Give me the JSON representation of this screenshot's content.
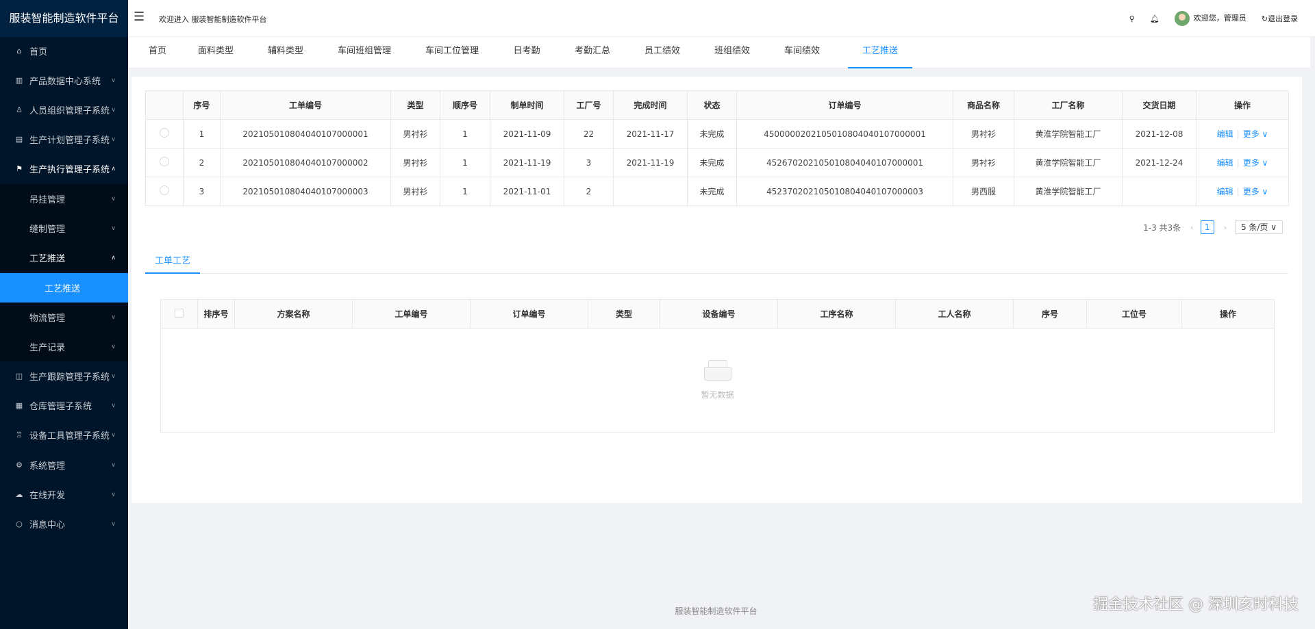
{
  "app": {
    "title": "服装智能制造软件平台"
  },
  "sidebar": {
    "items": [
      {
        "label": "首页",
        "icon": "home-icon"
      },
      {
        "label": "产品数据中心系统",
        "icon": "bank-icon"
      },
      {
        "label": "人员组织管理子系统",
        "icon": "user-icon"
      },
      {
        "label": "生产计划管理子系统",
        "icon": "plan-icon"
      },
      {
        "label": "生产执行管理子系统",
        "icon": "flag-icon"
      },
      {
        "label": "吊挂管理"
      },
      {
        "label": "缝制管理"
      },
      {
        "label": "工艺推送"
      },
      {
        "label": "工艺推送"
      },
      {
        "label": "物流管理"
      },
      {
        "label": "生产记录"
      },
      {
        "label": "生产跟踪管理子系统",
        "icon": "track-icon"
      },
      {
        "label": "仓库管理子系统",
        "icon": "warehouse-icon"
      },
      {
        "label": "设备工具管理子系统",
        "icon": "tool-icon"
      },
      {
        "label": "系统管理",
        "icon": "gear-icon"
      },
      {
        "label": "在线开发",
        "icon": "cloud-icon"
      },
      {
        "label": "消息中心",
        "icon": "message-icon"
      }
    ]
  },
  "header": {
    "welcome": "欢迎进入 服装智能制造软件平台",
    "greeting": "欢迎您，管理员",
    "logout": "退出登录"
  },
  "tabs": [
    "首页",
    "面料类型",
    "辅料类型",
    "车间班组管理",
    "车间工位管理",
    "日考勤",
    "考勤汇总",
    "员工绩效",
    "班组绩效",
    "车间绩效",
    "工艺推送"
  ],
  "table1": {
    "columns": [
      "",
      "序号",
      "工单编号",
      "类型",
      "顺序号",
      "制单时间",
      "工厂号",
      "完成时间",
      "状态",
      "订单编号",
      "商品名称",
      "工厂名称",
      "交货日期",
      "操作"
    ],
    "rows": [
      [
        "1",
        "202105010804040107000001",
        "男衬衫",
        "1",
        "2021-11-09",
        "22",
        "2021-11-17",
        "未完成",
        "4500000202105010804040107000001",
        "男衬衫",
        "黄淮学院智能工厂",
        "2021-12-08"
      ],
      [
        "2",
        "202105010804040107000002",
        "男衬衫",
        "1",
        "2021-11-19",
        "3",
        "2021-11-19",
        "未完成",
        "4526702021050108040401070000​01",
        "男衬衫",
        "黄淮学院智能工厂",
        "2021-12-24"
      ],
      [
        "3",
        "202105010804040107000003",
        "男衬衫",
        "1",
        "2021-11-01",
        "2",
        "",
        "未完成",
        "4523702021050108040401070000​03",
        "男西服",
        "黄淮学院智能工厂",
        ""
      ]
    ],
    "edit_label": "编辑",
    "more_label": "更多"
  },
  "pagination": {
    "summary": "1-3 共3条",
    "current": "1",
    "page_size": "5 条/页"
  },
  "subtab": "工单工艺",
  "table2": {
    "columns": [
      "",
      "排序号",
      "方案名称",
      "工单编号",
      "订单编号",
      "类型",
      "设备编号",
      "工序名称",
      "工人名称",
      "序号",
      "工位号",
      "操作"
    ],
    "empty_text": "暂无数据"
  },
  "footer": "服装智能制造软件平台",
  "watermark": "掘金技术社区 @ 深圳亥时科技"
}
